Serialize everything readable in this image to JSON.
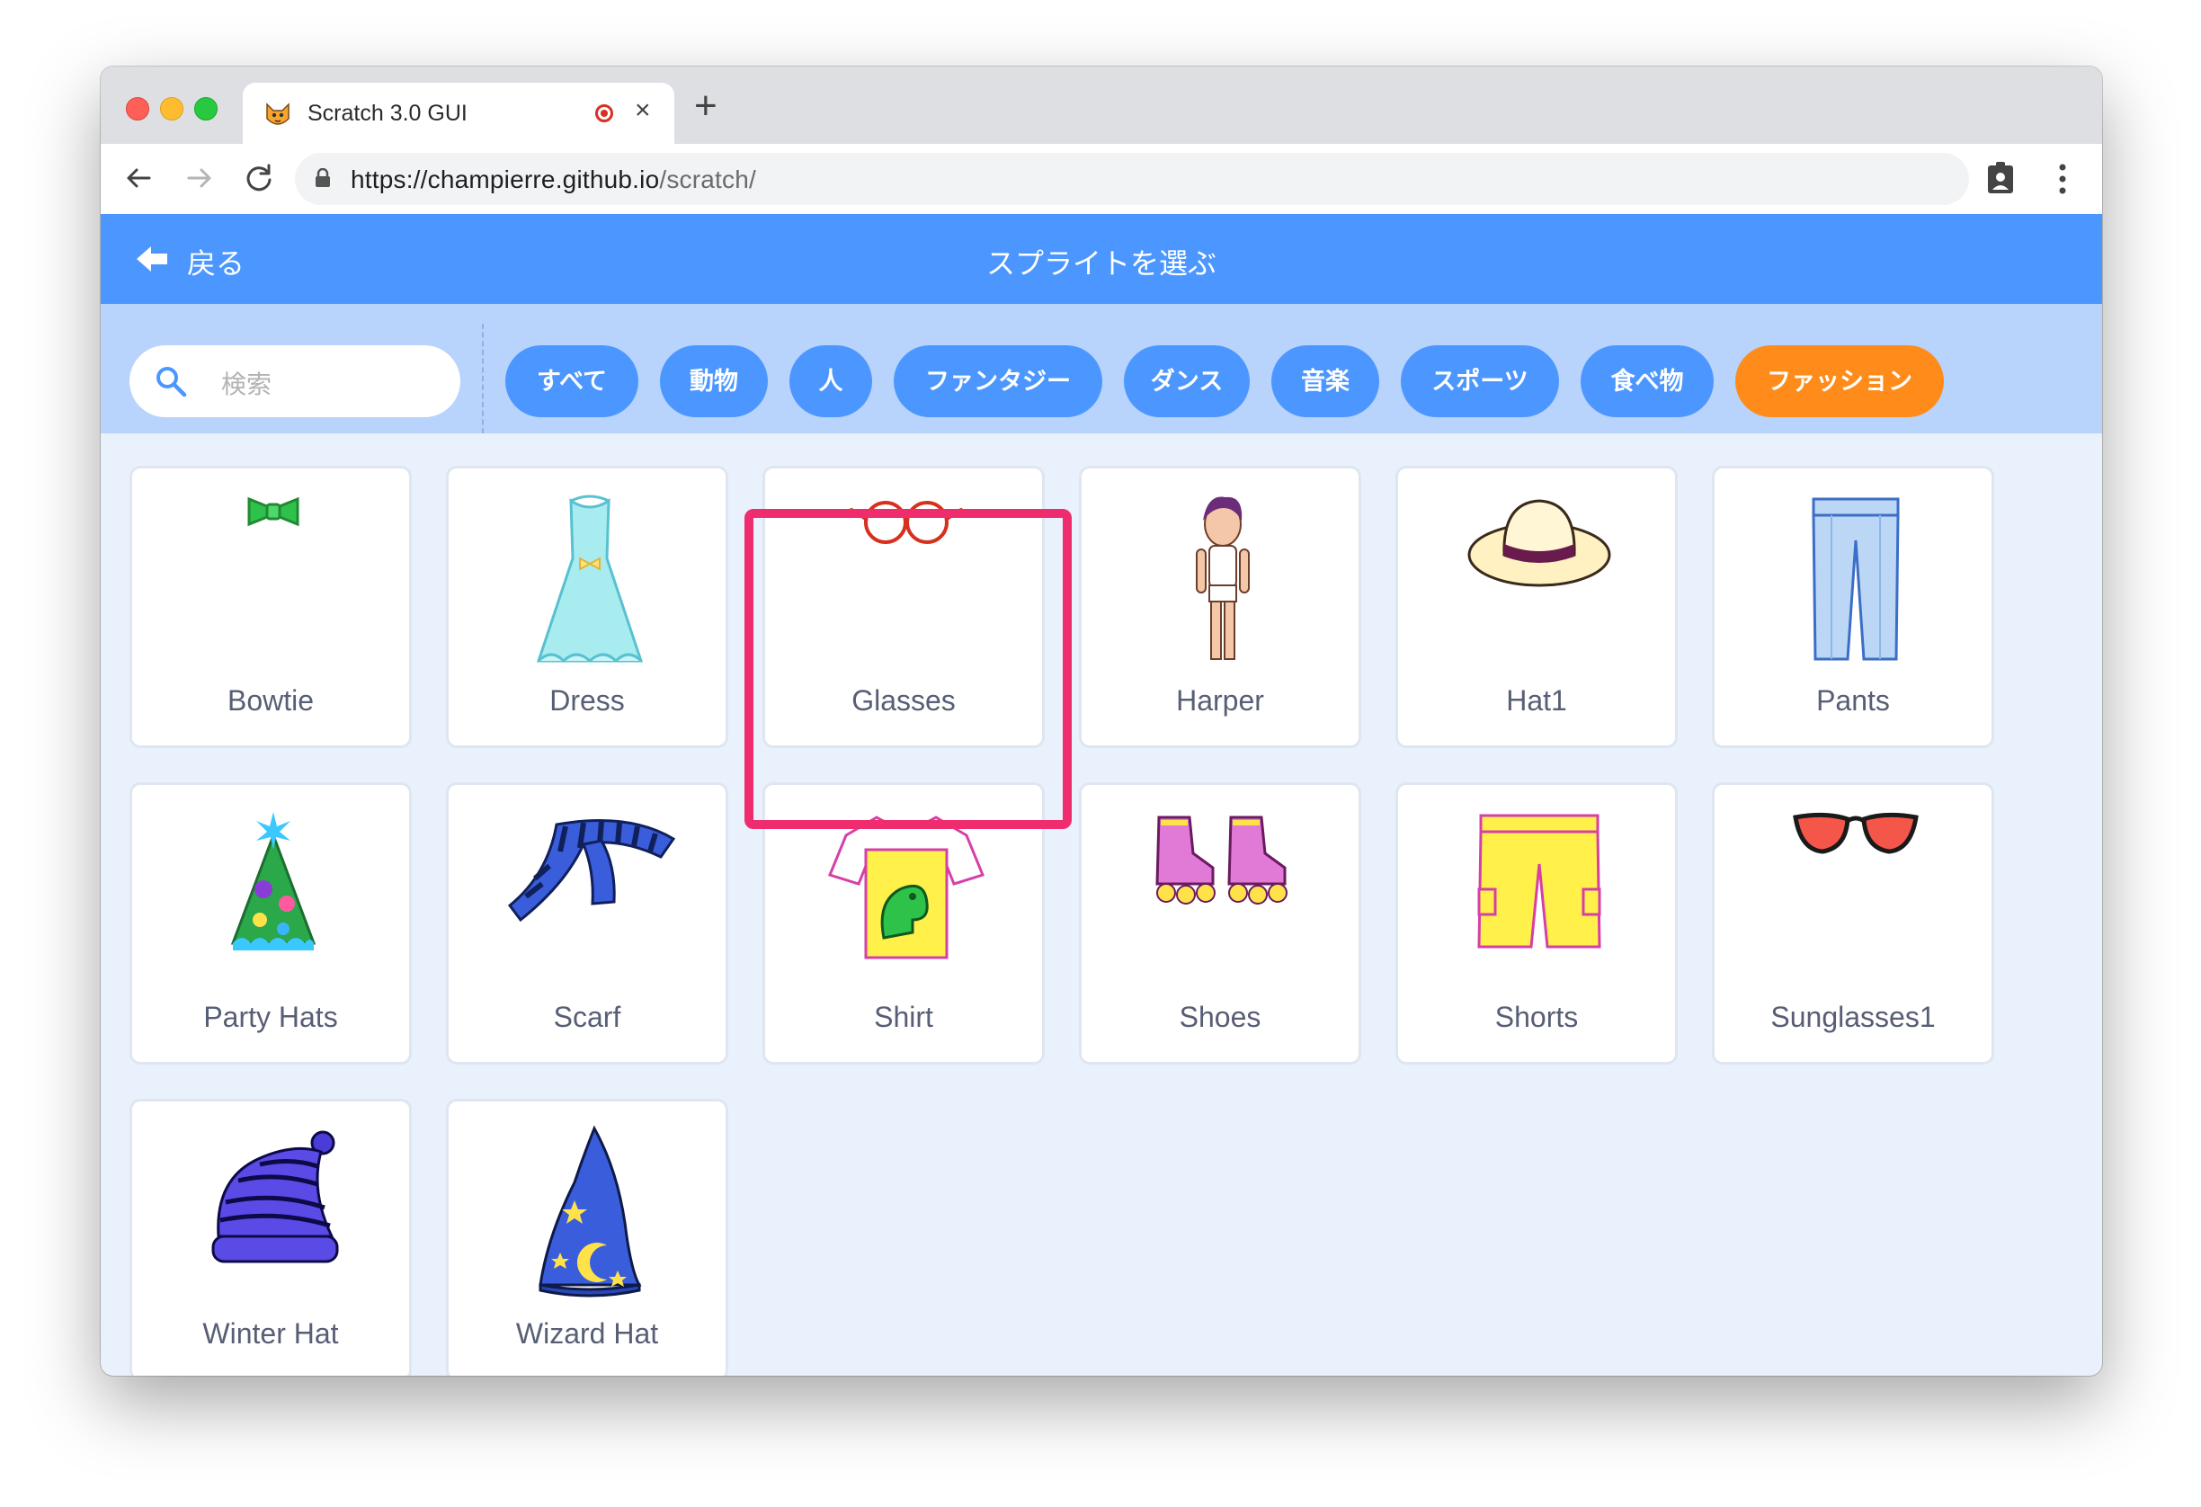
{
  "browser": {
    "tab_title": "Scratch 3.0 GUI",
    "url_host": "https://champierre.github.io",
    "url_path": "/scratch/"
  },
  "header": {
    "back_label": "戻る",
    "title": "スプライトを選ぶ"
  },
  "search": {
    "placeholder": "検索"
  },
  "categories": [
    {
      "label": "すべて",
      "active": false
    },
    {
      "label": "動物",
      "active": false
    },
    {
      "label": "人",
      "active": false
    },
    {
      "label": "ファンタジー",
      "active": false
    },
    {
      "label": "ダンス",
      "active": false
    },
    {
      "label": "音楽",
      "active": false
    },
    {
      "label": "スポーツ",
      "active": false
    },
    {
      "label": "食べ物",
      "active": false
    },
    {
      "label": "ファッション",
      "active": true
    }
  ],
  "sprites": [
    {
      "name": "Bowtie",
      "icon": "bowtie-icon"
    },
    {
      "name": "Dress",
      "icon": "dress-icon"
    },
    {
      "name": "Glasses",
      "icon": "glasses-icon",
      "highlighted": true
    },
    {
      "name": "Harper",
      "icon": "harper-icon"
    },
    {
      "name": "Hat1",
      "icon": "hat-icon"
    },
    {
      "name": "Pants",
      "icon": "pants-icon"
    },
    {
      "name": "Party Hats",
      "icon": "party-hat-icon"
    },
    {
      "name": "Scarf",
      "icon": "scarf-icon"
    },
    {
      "name": "Shirt",
      "icon": "shirt-icon"
    },
    {
      "name": "Shoes",
      "icon": "shoes-icon"
    },
    {
      "name": "Shorts",
      "icon": "shorts-icon"
    },
    {
      "name": "Sunglasses1",
      "icon": "sunglasses-icon"
    },
    {
      "name": "Winter Hat",
      "icon": "winter-hat-icon"
    },
    {
      "name": "Wizard Hat",
      "icon": "wizard-hat-icon"
    }
  ],
  "colors": {
    "header": "#4c97ff",
    "filter_bar": "#b8d3fc",
    "active_chip": "#ff8c1a",
    "highlight": "#ef2d6e"
  }
}
